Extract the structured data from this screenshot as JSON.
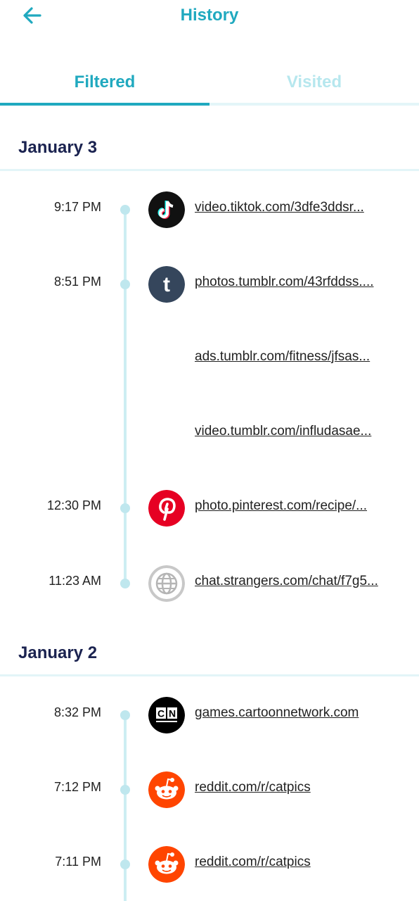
{
  "header": {
    "title": "History"
  },
  "tabs": [
    {
      "label": "Filtered",
      "active": true
    },
    {
      "label": "Visited",
      "active": false
    }
  ],
  "colors": {
    "accent": "#20a9bf",
    "inactive_tab": "#b6e7ee",
    "date_heading": "#1b2350",
    "timeline": "#cdeef3"
  },
  "groups": [
    {
      "date": "January 3",
      "entries": [
        {
          "time": "9:17 PM",
          "icon": "tiktok-icon",
          "url": "video.tiktok.com/3dfe3ddsr..."
        },
        {
          "time": "8:51 PM",
          "icon": "tumblr-icon",
          "url": "photos.tumblr.com/43rfddss...."
        },
        {
          "time": "",
          "icon": "",
          "url": "ads.tumblr.com/fitness/jfsas..."
        },
        {
          "time": "",
          "icon": "",
          "url": "video.tumblr.com/infludasae..."
        },
        {
          "time": "12:30 PM",
          "icon": "pinterest-icon",
          "url": "photo.pinterest.com/recipe/..."
        },
        {
          "time": "11:23 AM",
          "icon": "globe-icon",
          "url": "chat.strangers.com/chat/f7g5..."
        }
      ]
    },
    {
      "date": "January 2",
      "entries": [
        {
          "time": "8:32 PM",
          "icon": "cartoon-network-icon",
          "url": "games.cartoonnetwork.com"
        },
        {
          "time": "7:12 PM",
          "icon": "reddit-icon",
          "url": "reddit.com/r/catpics"
        },
        {
          "time": "7:11 PM",
          "icon": "reddit-icon",
          "url": "reddit.com/r/catpics"
        }
      ]
    }
  ]
}
